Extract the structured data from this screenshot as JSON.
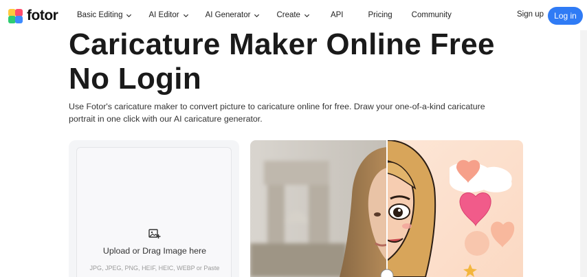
{
  "brand": {
    "name": "fotor"
  },
  "nav": {
    "items": [
      {
        "label": "Basic Editing",
        "has_dropdown": true
      },
      {
        "label": "AI Editor",
        "has_dropdown": true
      },
      {
        "label": "AI Generator",
        "has_dropdown": true
      },
      {
        "label": "Create",
        "has_dropdown": true
      },
      {
        "label": "API",
        "has_dropdown": false
      },
      {
        "label": "Pricing",
        "has_dropdown": false
      },
      {
        "label": "Community",
        "has_dropdown": false
      }
    ],
    "signup_label": "Sign up",
    "login_label": "Log in"
  },
  "hero": {
    "title_line1": "Caricature Maker Online Free",
    "title_line2": "No Login",
    "description": "Use Fotor's caricature maker to convert picture to caricature online for free. Draw your one-of-a-kind caricature portrait in one click with our AI caricature generator."
  },
  "upload": {
    "icon": "image-add-icon",
    "title": "Upload or Drag Image here",
    "formats": "JPG, JPEG, PNG, HEIF, HEIC, WEBP or Paste"
  },
  "preview": {
    "left_icon": "photo-portrait",
    "right_icon": "caricature-portrait"
  },
  "colors": {
    "accent": "#2f7bf5",
    "logo_yellow": "#ffc83d",
    "logo_red": "#ff4d6d",
    "logo_blue": "#3d8bff",
    "logo_green": "#2ecc71"
  }
}
